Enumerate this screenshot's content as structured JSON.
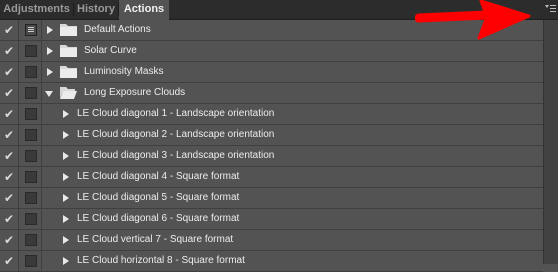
{
  "tabs": [
    {
      "label": "Adjustments",
      "active": false
    },
    {
      "label": "History",
      "active": false
    },
    {
      "label": "Actions",
      "active": true
    }
  ],
  "rows": [
    {
      "type": "set",
      "expanded": false,
      "dialog": true,
      "label": "Default Actions"
    },
    {
      "type": "set",
      "expanded": false,
      "dialog": false,
      "label": "Solar Curve"
    },
    {
      "type": "set",
      "expanded": false,
      "dialog": false,
      "label": "Luminosity Masks"
    },
    {
      "type": "set",
      "expanded": true,
      "dialog": false,
      "label": "Long Exposure Clouds"
    },
    {
      "type": "action",
      "label": "LE Cloud diagonal 1 - Landscape orientation"
    },
    {
      "type": "action",
      "label": "LE Cloud diagonal 2 - Landscape orientation"
    },
    {
      "type": "action",
      "label": "LE Cloud diagonal 3 - Landscape orientation"
    },
    {
      "type": "action",
      "label": "LE Cloud diagonal 4 - Square format"
    },
    {
      "type": "action",
      "label": "LE Cloud diagonal 5 - Square format"
    },
    {
      "type": "action",
      "label": "LE Cloud diagonal 6 - Square format"
    },
    {
      "type": "action",
      "label": "LE Cloud vertical 7 - Square format"
    },
    {
      "type": "action",
      "label": "LE Cloud horizontal 8 - Square format"
    }
  ],
  "icons": {
    "check": "checkmark-icon",
    "dialog": "dialog-toggle-icon",
    "folder": "folder-icon",
    "panel_menu": "panel-menu-icon",
    "annotation": "red-arrow-icon"
  },
  "colors": {
    "panel_bg": "#535353",
    "tab_bar_bg": "#2c2c2c",
    "annotation_arrow": "#ff0000"
  }
}
